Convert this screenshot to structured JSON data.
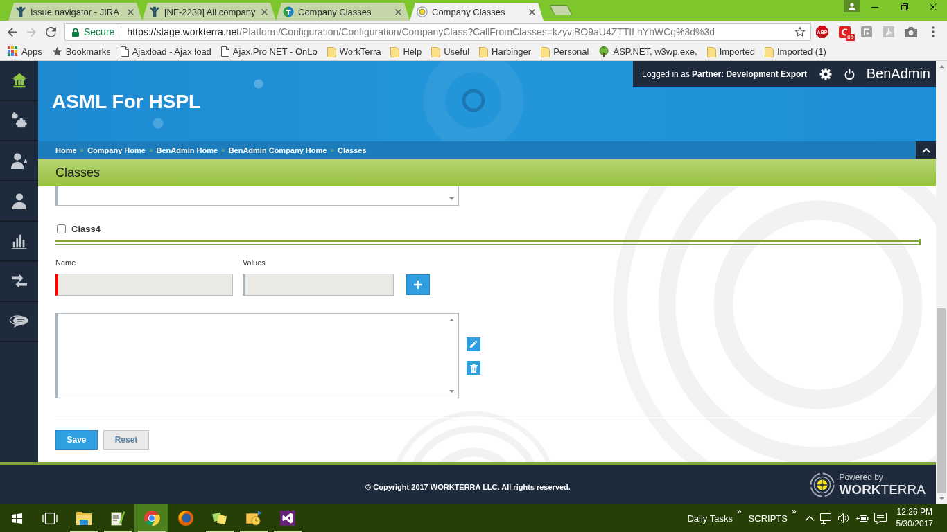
{
  "browser": {
    "tabs": [
      {
        "title": "Issue navigator - JIRA",
        "kind": "figure",
        "selected": false
      },
      {
        "title": "[NF-2230] All company",
        "kind": "figure",
        "selected": false
      },
      {
        "title": "Company Classes",
        "kind": "shield",
        "selected": false
      },
      {
        "title": "Company Classes",
        "kind": "ring",
        "selected": true
      }
    ],
    "navigation": {
      "back_disabled": false,
      "forward_disabled": true
    },
    "address": {
      "security": "Secure",
      "host": "https://stage.workterra.net",
      "path": "/Platform/Configuration/Configuration/CompanyClass?CallFromClasses=kzyvjBO9aU4ZTTILhYhWCg%3d%3d"
    },
    "extensions": [
      {
        "kind": "octagon",
        "label": "ABP"
      },
      {
        "kind": "clip",
        "badge": "85"
      },
      {
        "kind": "frame"
      },
      {
        "kind": "pdf"
      },
      {
        "kind": "camera"
      }
    ],
    "bookmarks": [
      {
        "label": "Apps",
        "kind": "grid"
      },
      {
        "label": "Bookmarks",
        "kind": "star"
      },
      {
        "label": "Ajaxload - Ajax load",
        "kind": "page"
      },
      {
        "label": "Ajax.Pro NET - OnLo",
        "kind": "page"
      },
      {
        "label": "WorkTerra",
        "kind": "folder"
      },
      {
        "label": "Help",
        "kind": "folder"
      },
      {
        "label": "Useful",
        "kind": "folder"
      },
      {
        "label": "Harbinger",
        "kind": "folder"
      },
      {
        "label": "Personal",
        "kind": "folder"
      },
      {
        "label": "ASP.NET, w3wp.exe,",
        "kind": "tree"
      },
      {
        "label": "Imported",
        "kind": "folder"
      },
      {
        "label": "Imported (1)",
        "kind": "folder"
      }
    ]
  },
  "sidebar": [
    {
      "kind": "home",
      "selected": true
    },
    {
      "kind": "puzzle",
      "selected": false
    },
    {
      "kind": "user-star",
      "selected": false
    },
    {
      "kind": "user",
      "selected": false
    },
    {
      "kind": "chart",
      "selected": false
    },
    {
      "kind": "transfer",
      "selected": false
    },
    {
      "kind": "chat",
      "selected": false
    }
  ],
  "header": {
    "title": "ASML For HSPL",
    "login": "Logged in as **Partner: Development Export**",
    "product": "BenAdmin"
  },
  "breadcrumbs": [
    {
      "label": "Home",
      "separator": "»"
    },
    {
      "label": "Company Home",
      "separator": "»"
    },
    {
      "label": "BenAdmin Home",
      "separator": "»"
    },
    {
      "label": "BenAdmin Company Home",
      "separator": "»"
    },
    {
      "label": "Classes"
    }
  ],
  "page_title": "Classes",
  "form": {
    "class_name": "Class4",
    "class_checked": false,
    "fields": [
      {
        "label": "Name",
        "required": true
      },
      {
        "label": "Values",
        "required": false
      }
    ]
  },
  "buttons": [
    {
      "label": "Save",
      "kind": "primary"
    },
    {
      "label": "Reset",
      "kind": "secondary"
    }
  ],
  "footer": {
    "copyright": "© Copyright 2017 WORKTERRA LLC. All rights reserved.",
    "powered_by": "Powered by",
    "brand": "**WORK**TERRA"
  },
  "taskbar": {
    "apps": [
      {
        "kind": "folder",
        "running": true,
        "selected": false
      },
      {
        "kind": "notepad",
        "running": true,
        "selected": false
      },
      {
        "kind": "ball",
        "running": true,
        "selected": true
      },
      {
        "kind": "fox",
        "running": false,
        "selected": false
      },
      {
        "kind": "notes",
        "running": true,
        "selected": false
      },
      {
        "kind": "mail-clock",
        "running": true,
        "selected": false
      },
      {
        "kind": "ribbon",
        "running": true,
        "selected": false
      }
    ],
    "toolbars": [
      {
        "label": "Daily Tasks",
        "chevron": "»"
      },
      {
        "label": "SCRIPTS",
        "chevron": "»"
      }
    ],
    "time": "12:26 PM",
    "date": "5/30/2017"
  }
}
